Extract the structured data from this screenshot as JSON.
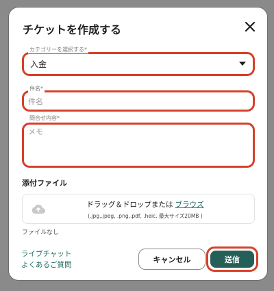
{
  "dialog": {
    "title": "チケットを作成する"
  },
  "category": {
    "label": "カテゴリーを選択する*",
    "value": "入金"
  },
  "subject": {
    "label": "件名*",
    "placeholder": "件名"
  },
  "message": {
    "label": "問合せ内容*",
    "placeholder": "メモ"
  },
  "attachments": {
    "heading": "添付ファイル",
    "drop_text": "ドラッグ＆ドロップまたは",
    "browse_label": "ブラウズ",
    "formats_note": "(.jpg,.jpeg, .png,.pdf, .heic. 最大サイズ20MB )",
    "status": "ファイルなし"
  },
  "footer": {
    "live_chat": "ライブチャット",
    "faq": "よくあるご質問",
    "cancel_label": "キャンセル",
    "send_label": "送信"
  },
  "colors": {
    "accent": "#265f58",
    "highlight": "#d6402a",
    "link": "#1e6a5f"
  },
  "icons": {
    "close": "close-icon",
    "caret": "chevron-down-icon",
    "upload": "cloud-upload-icon"
  }
}
